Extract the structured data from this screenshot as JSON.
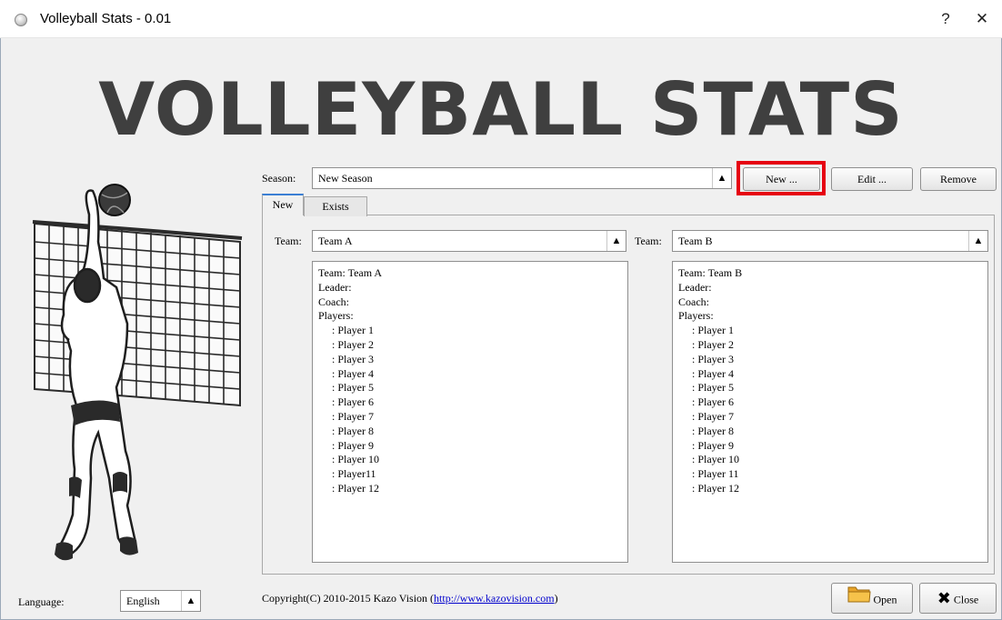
{
  "window": {
    "title": "Volleyball Stats - 0.01",
    "help": "?",
    "close": "✕"
  },
  "banner": {
    "text": "VOLLEYBALL STATS"
  },
  "season": {
    "label": "Season:",
    "value": "New Season",
    "new_button": "New ...",
    "edit_button": "Edit ...",
    "remove_button": "Remove"
  },
  "tabs": [
    {
      "label": "New",
      "active": true
    },
    {
      "label": "Exists",
      "active": false
    }
  ],
  "team_a": {
    "label": "Team:",
    "value": "Team A",
    "details": "Team: Team A\nLeader:\nCoach:\nPlayers:\n     : Player 1\n     : Player 2\n     : Player 3\n     : Player 4\n     : Player 5\n     : Player 6\n     : Player 7\n     : Player 8\n     : Player 9\n     : Player 10\n     : Player11\n     : Player 12"
  },
  "team_b": {
    "label": "Team:",
    "value": "Team B",
    "details": "Team: Team B\nLeader:\nCoach:\nPlayers:\n     : Player 1\n     : Player 2\n     : Player 3\n     : Player 4\n     : Player 5\n     : Player 6\n     : Player 7\n     : Player 8\n     : Player 9\n     : Player 10\n     : Player 11\n     : Player 12"
  },
  "footer": {
    "language_label": "Language:",
    "language_value": "English",
    "copyright": "Copyright(C) 2010-2015 Kazo Vision (",
    "copyright_link": "http://www.kazovision.com",
    "copyright_end": ")",
    "open_button": "Open",
    "close_button": "Close"
  },
  "colors": {
    "highlight": "#e60012",
    "tab_accent": "#3b7fd4",
    "banner": "#3f3f3f"
  },
  "icons": [
    "volleyball-app-icon",
    "volleyball-player-illustration",
    "folder-icon",
    "x-close-icon",
    "updown-arrow-icon"
  ]
}
